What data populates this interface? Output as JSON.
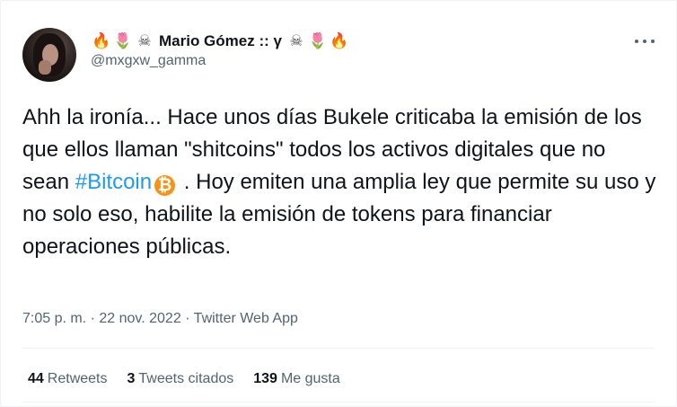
{
  "user": {
    "display_name": "Mario Gómez :: γ",
    "handle": "@mxgxw_gamma",
    "name_emoji_left": [
      "🔥",
      "🌷",
      "☠"
    ],
    "name_emoji_right": [
      "☠",
      "🌷",
      "🔥"
    ]
  },
  "tweet": {
    "text_before": "Ahh la ironía... Hace unos días Bukele criticaba la emisión de los que ellos llaman \"shitcoins\" todos los activos digitales que no sean ",
    "hashtag": "#Bitcoin",
    "bitcoin_symbol": "₿",
    "text_after": " . Hoy emiten una amplia ley que permite su uso y no solo eso, habilite la emisión de tokens para financiar operaciones públicas.",
    "time": "7:05 p. m.",
    "separator": "·",
    "date": "22 nov. 2022",
    "source": "Twitter Web App"
  },
  "stats": {
    "retweets_count": "44",
    "retweets_label": "Retweets",
    "quotes_count": "3",
    "quotes_label": "Tweets citados",
    "likes_count": "139",
    "likes_label": "Me gusta"
  },
  "icons": {
    "more": "more-dots-icon",
    "bitcoin": "bitcoin-icon"
  },
  "colors": {
    "link": "#1d9bf0",
    "secondary_text": "#536471",
    "bitcoin": "#f7931a"
  }
}
